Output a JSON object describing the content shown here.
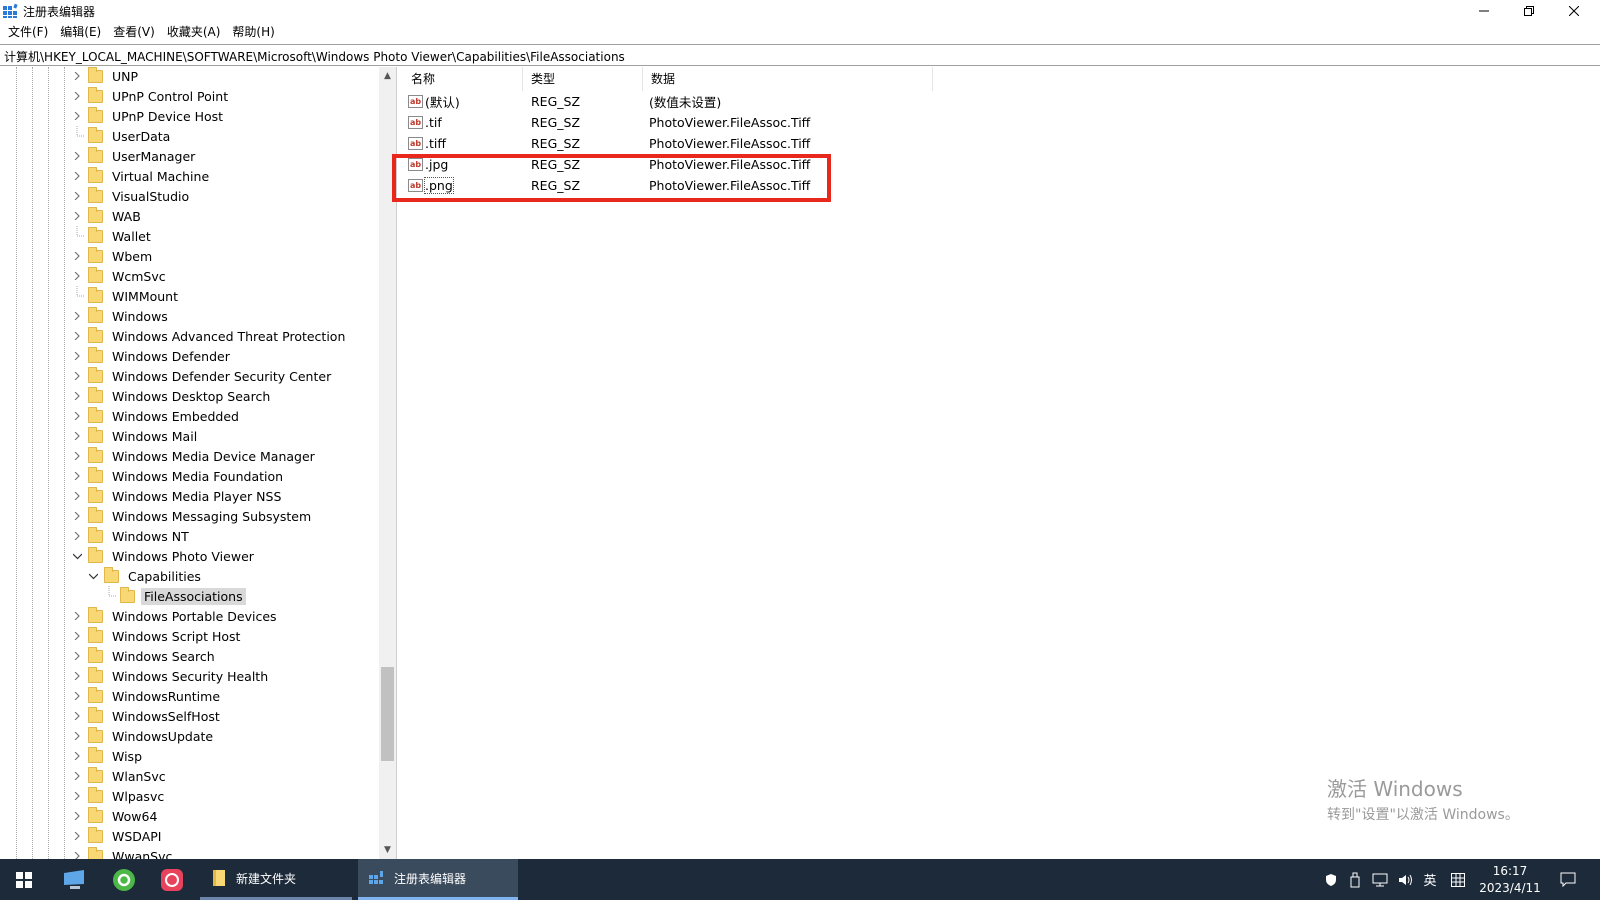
{
  "window": {
    "title": "注册表编辑器",
    "icon": "regedit-icon"
  },
  "menu": [
    "文件(F)",
    "编辑(E)",
    "查看(V)",
    "收藏夹(A)",
    "帮助(H)"
  ],
  "address": "计算机\\HKEY_LOCAL_MACHINE\\SOFTWARE\\Microsoft\\Windows Photo Viewer\\Capabilities\\FileAssociations",
  "tree": [
    {
      "label": "UNP",
      "level": 0,
      "expander": "collapsed"
    },
    {
      "label": "UPnP Control Point",
      "level": 0,
      "expander": "collapsed"
    },
    {
      "label": "UPnP Device Host",
      "level": 0,
      "expander": "collapsed"
    },
    {
      "label": "UserData",
      "level": 0,
      "expander": "none"
    },
    {
      "label": "UserManager",
      "level": 0,
      "expander": "collapsed"
    },
    {
      "label": "Virtual Machine",
      "level": 0,
      "expander": "collapsed"
    },
    {
      "label": "VisualStudio",
      "level": 0,
      "expander": "collapsed"
    },
    {
      "label": "WAB",
      "level": 0,
      "expander": "collapsed"
    },
    {
      "label": "Wallet",
      "level": 0,
      "expander": "none"
    },
    {
      "label": "Wbem",
      "level": 0,
      "expander": "collapsed"
    },
    {
      "label": "WcmSvc",
      "level": 0,
      "expander": "collapsed"
    },
    {
      "label": "WIMMount",
      "level": 0,
      "expander": "none"
    },
    {
      "label": "Windows",
      "level": 0,
      "expander": "collapsed"
    },
    {
      "label": "Windows Advanced Threat Protection",
      "level": 0,
      "expander": "collapsed"
    },
    {
      "label": "Windows Defender",
      "level": 0,
      "expander": "collapsed"
    },
    {
      "label": "Windows Defender Security Center",
      "level": 0,
      "expander": "collapsed"
    },
    {
      "label": "Windows Desktop Search",
      "level": 0,
      "expander": "collapsed"
    },
    {
      "label": "Windows Embedded",
      "level": 0,
      "expander": "collapsed"
    },
    {
      "label": "Windows Mail",
      "level": 0,
      "expander": "collapsed"
    },
    {
      "label": "Windows Media Device Manager",
      "level": 0,
      "expander": "collapsed"
    },
    {
      "label": "Windows Media Foundation",
      "level": 0,
      "expander": "collapsed"
    },
    {
      "label": "Windows Media Player NSS",
      "level": 0,
      "expander": "collapsed"
    },
    {
      "label": "Windows Messaging Subsystem",
      "level": 0,
      "expander": "collapsed"
    },
    {
      "label": "Windows NT",
      "level": 0,
      "expander": "collapsed"
    },
    {
      "label": "Windows Photo Viewer",
      "level": 0,
      "expander": "expanded"
    },
    {
      "label": "Capabilities",
      "level": 1,
      "expander": "expanded"
    },
    {
      "label": "FileAssociations",
      "level": 2,
      "expander": "none",
      "selected": true
    },
    {
      "label": "Windows Portable Devices",
      "level": 0,
      "expander": "collapsed"
    },
    {
      "label": "Windows Script Host",
      "level": 0,
      "expander": "collapsed"
    },
    {
      "label": "Windows Search",
      "level": 0,
      "expander": "collapsed"
    },
    {
      "label": "Windows Security Health",
      "level": 0,
      "expander": "collapsed"
    },
    {
      "label": "WindowsRuntime",
      "level": 0,
      "expander": "collapsed"
    },
    {
      "label": "WindowsSelfHost",
      "level": 0,
      "expander": "collapsed"
    },
    {
      "label": "WindowsUpdate",
      "level": 0,
      "expander": "collapsed"
    },
    {
      "label": "Wisp",
      "level": 0,
      "expander": "collapsed"
    },
    {
      "label": "WlanSvc",
      "level": 0,
      "expander": "collapsed"
    },
    {
      "label": "Wlpasvc",
      "level": 0,
      "expander": "collapsed"
    },
    {
      "label": "Wow64",
      "level": 0,
      "expander": "collapsed"
    },
    {
      "label": "WSDAPI",
      "level": 0,
      "expander": "collapsed"
    },
    {
      "label": "WwanSvc",
      "level": 0,
      "expander": "collapsed"
    }
  ],
  "values": {
    "headers": {
      "name": "名称",
      "type": "类型",
      "data": "数据"
    },
    "rows": [
      {
        "name": "(默认)",
        "type": "REG_SZ",
        "data": "(数值未设置)"
      },
      {
        "name": ".tif",
        "type": "REG_SZ",
        "data": "PhotoViewer.FileAssoc.Tiff"
      },
      {
        "name": ".tiff",
        "type": "REG_SZ",
        "data": "PhotoViewer.FileAssoc.Tiff"
      },
      {
        "name": ".jpg",
        "type": "REG_SZ",
        "data": "PhotoViewer.FileAssoc.Tiff"
      },
      {
        "name": ".png",
        "type": "REG_SZ",
        "data": "PhotoViewer.FileAssoc.Tiff",
        "focused": true
      }
    ]
  },
  "watermark": {
    "line1": "激活 Windows",
    "line2": "转到\"设置\"以激活 Windows。"
  },
  "taskbar": {
    "explorer_label": "新建文件夹",
    "regedit_label": "注册表编辑器",
    "ime": "英",
    "time": "16:17",
    "date": "2023/4/11"
  },
  "colors": {
    "highlight": "#e8271d",
    "taskbar": "#1c2a3a",
    "folder": "#f8d775"
  }
}
